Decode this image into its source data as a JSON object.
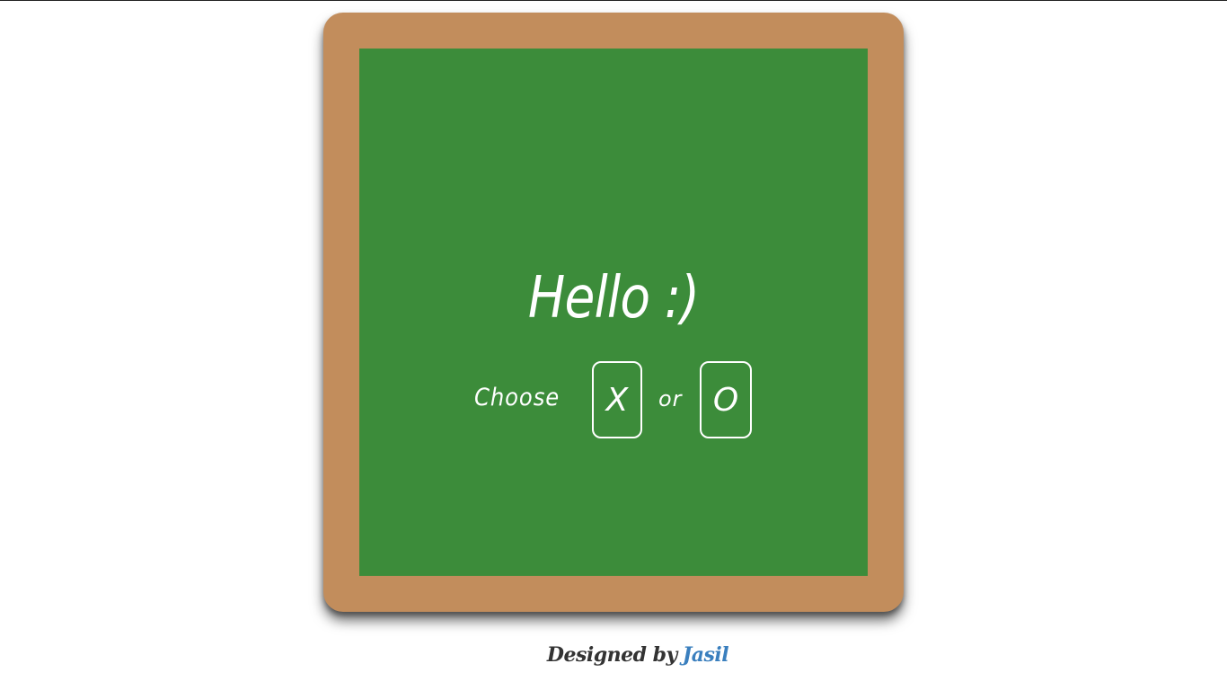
{
  "game": {
    "greeting": "Hello :)",
    "choose_label": "Choose",
    "option_x": "X",
    "or_label": "or",
    "option_o": "O"
  },
  "footer": {
    "designed_by": "Designed by",
    "author": "Jasil"
  },
  "colors": {
    "frame": "#c28d5c",
    "board": "#3c8c3a",
    "chalk": "#ffffff",
    "author_link": "#3a7fbe",
    "credit_text": "#333333"
  }
}
